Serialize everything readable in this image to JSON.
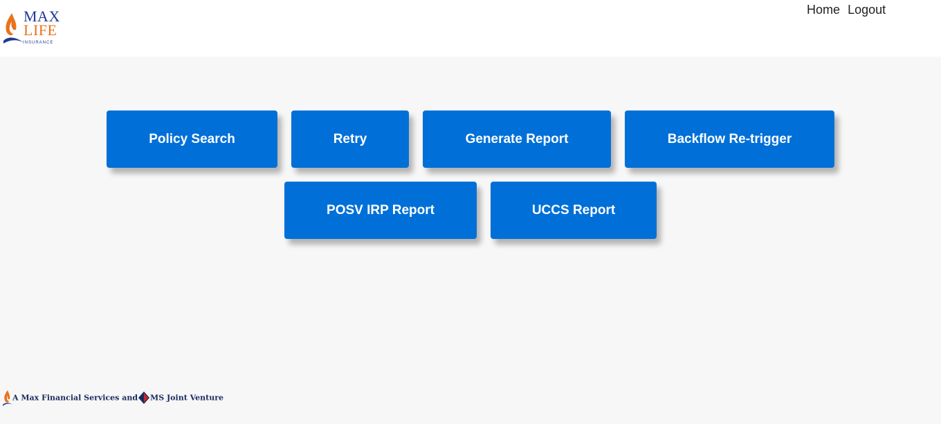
{
  "brand": {
    "logo_line1": "MAX",
    "logo_line2": "LIFE",
    "logo_line3": "INSURANCE",
    "primary_color": "#0070d8",
    "navy_color": "#1f3a93",
    "orange_color": "#e8731d"
  },
  "nav": {
    "home_label": "Home",
    "logout_label": "Logout"
  },
  "tiles": [
    {
      "label": "Policy Search"
    },
    {
      "label": "Retry"
    },
    {
      "label": "Generate Report"
    },
    {
      "label": "Backflow Re-trigger"
    },
    {
      "label": "POSV IRP Report"
    },
    {
      "label": "UCCS Report"
    }
  ],
  "footer": {
    "text_part1": "A Max Financial Services and",
    "text_part2": "MS Joint Venture"
  }
}
